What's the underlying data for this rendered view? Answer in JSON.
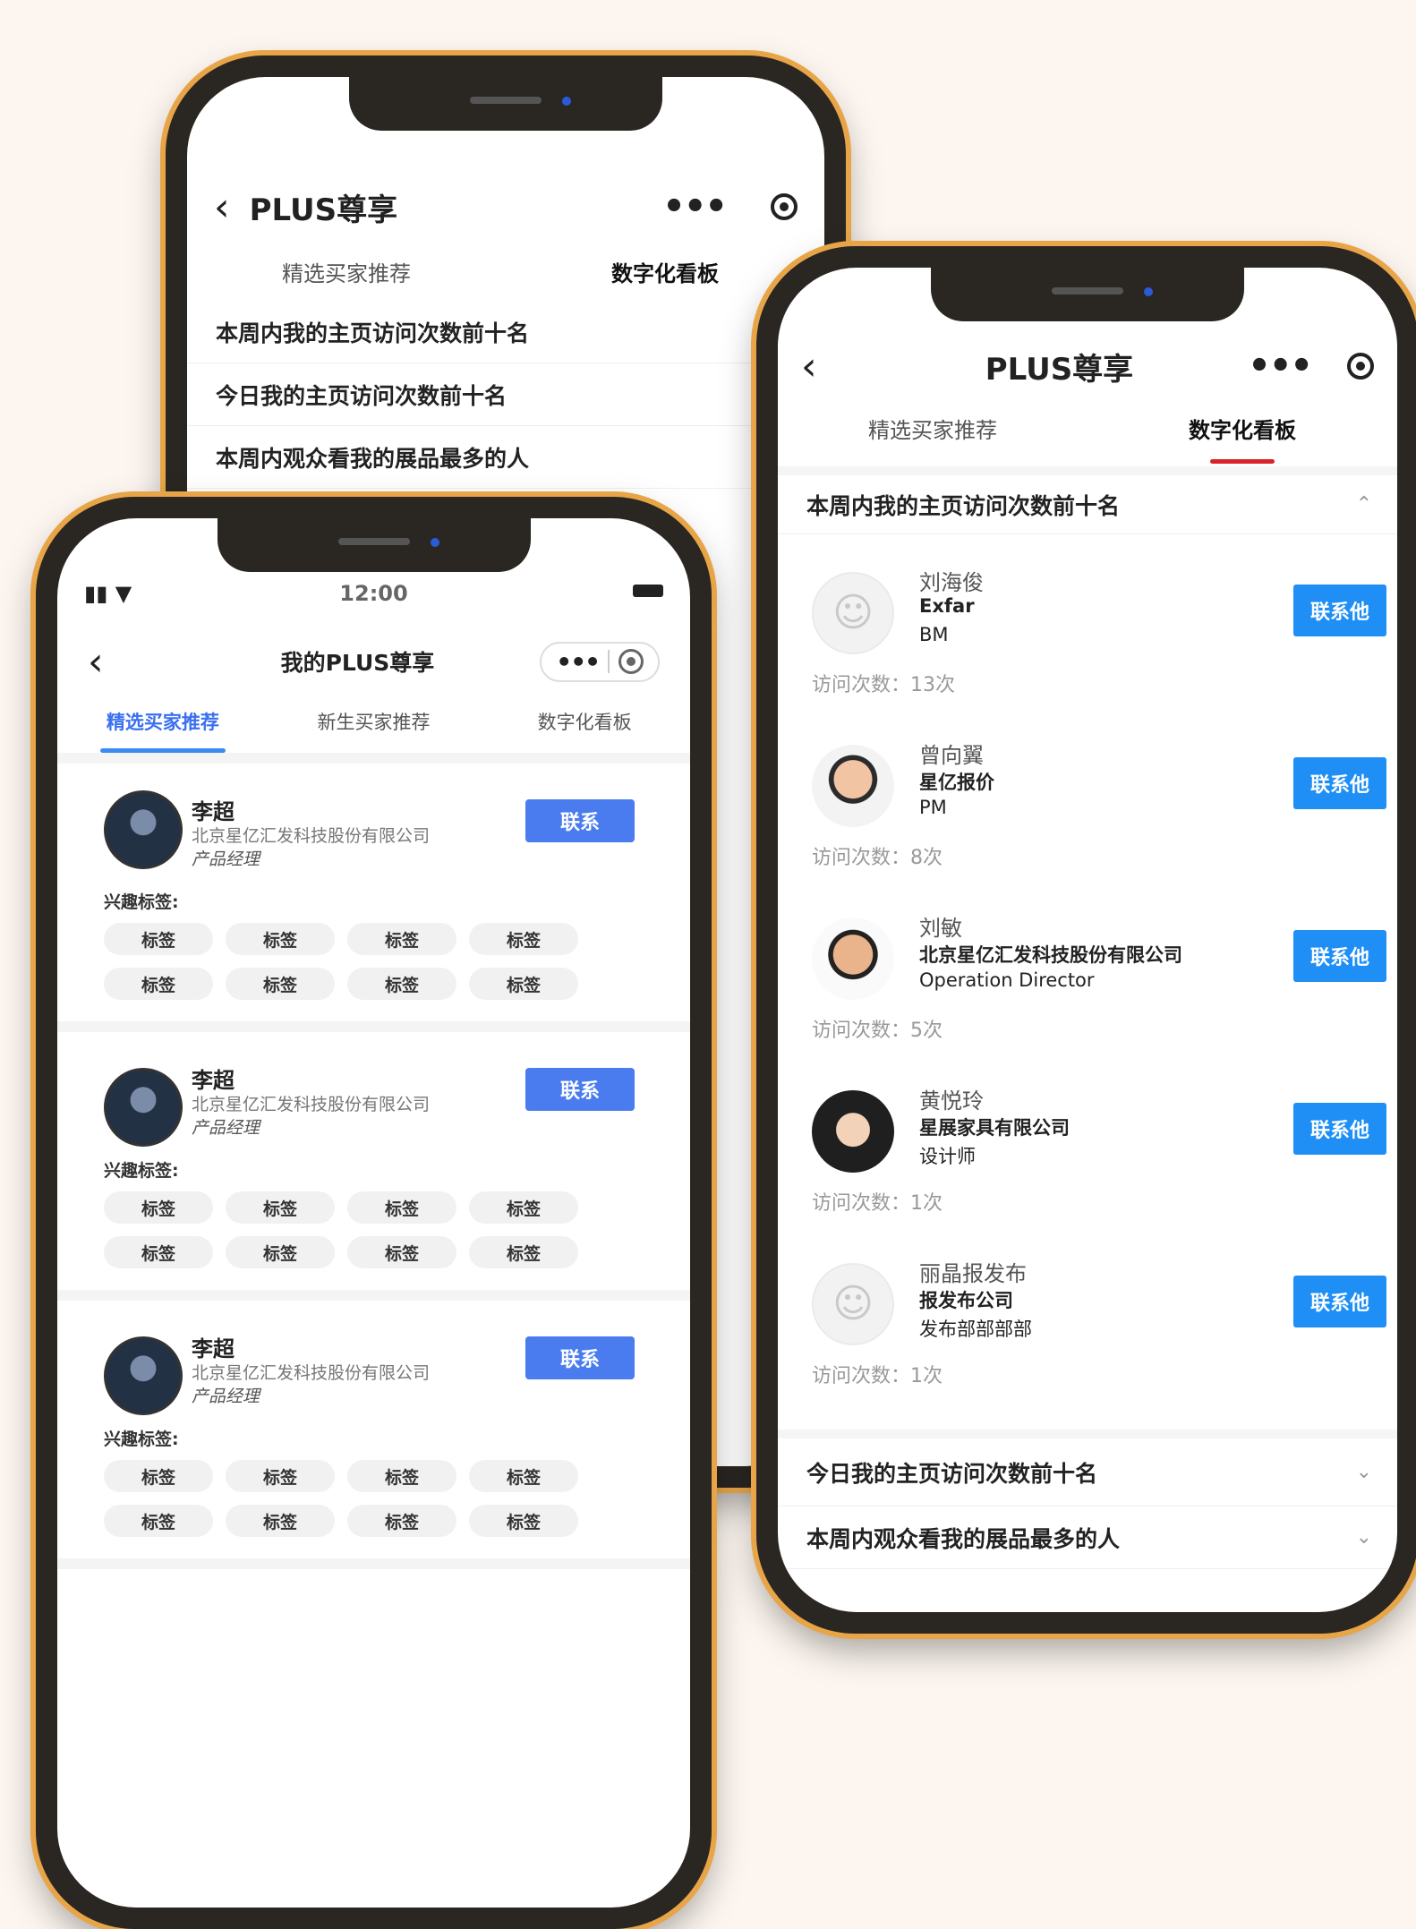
{
  "phone_back": {
    "nav_title": "PLUS尊享",
    "tabs": [
      {
        "label": "精选买家推荐",
        "active": false
      },
      {
        "label": "数字化看板",
        "active": true
      }
    ],
    "sections": [
      "本周内我的主页访问次数前十名",
      "今日我的主页访问次数前十名",
      "本周内观众看我的展品最多的人"
    ]
  },
  "phone_front_left": {
    "status_time": "12:00",
    "nav_title": "我的PLUS尊享",
    "tabs": [
      {
        "label": "精选买家推荐",
        "active": true
      },
      {
        "label": "新生买家推荐",
        "active": false
      },
      {
        "label": "数字化看板",
        "active": false
      }
    ],
    "cards": [
      {
        "name": "李超",
        "company": "北京星亿汇发科技股份有限公司",
        "title": "产品经理",
        "button": "联系",
        "tags_label": "兴趣标签:",
        "tags": [
          "标签",
          "标签",
          "标签",
          "标签",
          "标签",
          "标签",
          "标签",
          "标签"
        ]
      },
      {
        "name": "李超",
        "company": "北京星亿汇发科技股份有限公司",
        "title": "产品经理",
        "button": "联系",
        "tags_label": "兴趣标签:",
        "tags": [
          "标签",
          "标签",
          "标签",
          "标签",
          "标签",
          "标签",
          "标签",
          "标签"
        ]
      },
      {
        "name": "李超",
        "company": "北京星亿汇发科技股份有限公司",
        "title": "产品经理",
        "button": "联系",
        "tags_label": "兴趣标签:",
        "tags": [
          "标签",
          "标签",
          "标签",
          "标签",
          "标签",
          "标签",
          "标签",
          "标签"
        ]
      }
    ]
  },
  "phone_right": {
    "nav_title": "PLUS尊享",
    "tabs": [
      {
        "label": "精选买家推荐",
        "active": false
      },
      {
        "label": "数字化看板",
        "active": true
      }
    ],
    "section_open": "本周内我的主页访问次数前十名",
    "visitors": [
      {
        "name": "刘海俊",
        "company": "Exfar",
        "title": "BM",
        "count": "访问次数：13次",
        "button": "联系他"
      },
      {
        "name": "曾向翼",
        "company": "星亿报价",
        "title": "PM",
        "count": "访问次数：8次",
        "button": "联系他"
      },
      {
        "name": "刘敏",
        "company": "北京星亿汇发科技股份有限公司",
        "title": "Operation Director",
        "count": "访问次数：5次",
        "button": "联系他"
      },
      {
        "name": "黄悦玲",
        "company": "星展家具有限公司",
        "title": "设计师",
        "count": "访问次数：1次",
        "button": "联系他"
      },
      {
        "name": "丽晶报发布",
        "company": "报发布公司",
        "title": "发布部部部部",
        "count": "访问次数：1次",
        "button": "联系他"
      }
    ],
    "sections_collapsed": [
      "今日我的主页访问次数前十名",
      "本周内观众看我的展品最多的人"
    ]
  }
}
